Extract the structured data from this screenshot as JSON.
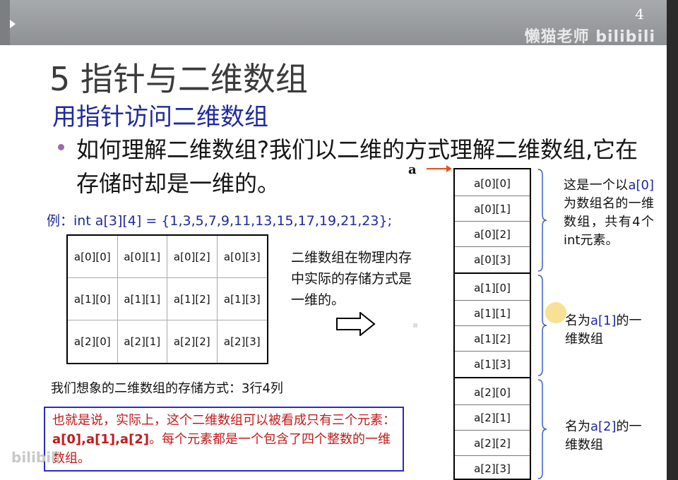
{
  "header": {
    "page_number": "4",
    "watermark": "懒猫老师 bilibili",
    "watermark_bottom": "bilibili"
  },
  "title": "5   指针与二维数组",
  "subtitle": "用指针访问二维数组",
  "bullet": "如何理解二维数组?我们以二维的方式理解二维数组,它在存储时却是一维的。",
  "pointer_label": "a",
  "example": "例：int a[3][4] = {1,3,5,7,9,11,13,15,17,19,21,23};",
  "grid": [
    [
      "a[0][0]",
      "a[0][1]",
      "a[0][2]",
      "a[0][3]"
    ],
    [
      "a[1][0]",
      "a[1][1]",
      "a[1][2]",
      "a[1][3]"
    ],
    [
      "a[2][0]",
      "a[2][1]",
      "a[2][2]",
      "a[2][3]"
    ]
  ],
  "physical_note": "二维数组在物理内存中实际的存储方式是一维的。",
  "imagine": "我们想象的二维数组的存储方式：3行4列",
  "explain": {
    "part1": "也就是说，实际上，这个二维数组可以被看成只有三个元素：",
    "bold": "a[0],a[1],a[2]",
    "part2": "。每个元素都是一个包含了四个整数的一维数组。"
  },
  "memory": [
    "a[0][0]",
    "a[0][1]",
    "a[0][2]",
    "a[0][3]",
    "a[1][0]",
    "a[1][1]",
    "a[1][2]",
    "a[1][3]",
    "a[2][0]",
    "a[2][1]",
    "a[2][2]",
    "a[2][3]"
  ],
  "notes": {
    "n0_pre": "这是一个以",
    "n0_name": "a[0]",
    "n0_post": "为数组名的一维数组，共有4个int元素。",
    "n1_pre": "名为",
    "n1_name": "a[1]",
    "n1_post": "的一维数组",
    "n2_pre": "名为",
    "n2_name": "a[2]",
    "n2_post": "的一维数组"
  },
  "colors": {
    "subtitle_blue": "#1f2a9e",
    "explain_red": "#c41a1a",
    "arrow_orange": "#e8501e",
    "brace_blue": "#3a5fd0"
  }
}
